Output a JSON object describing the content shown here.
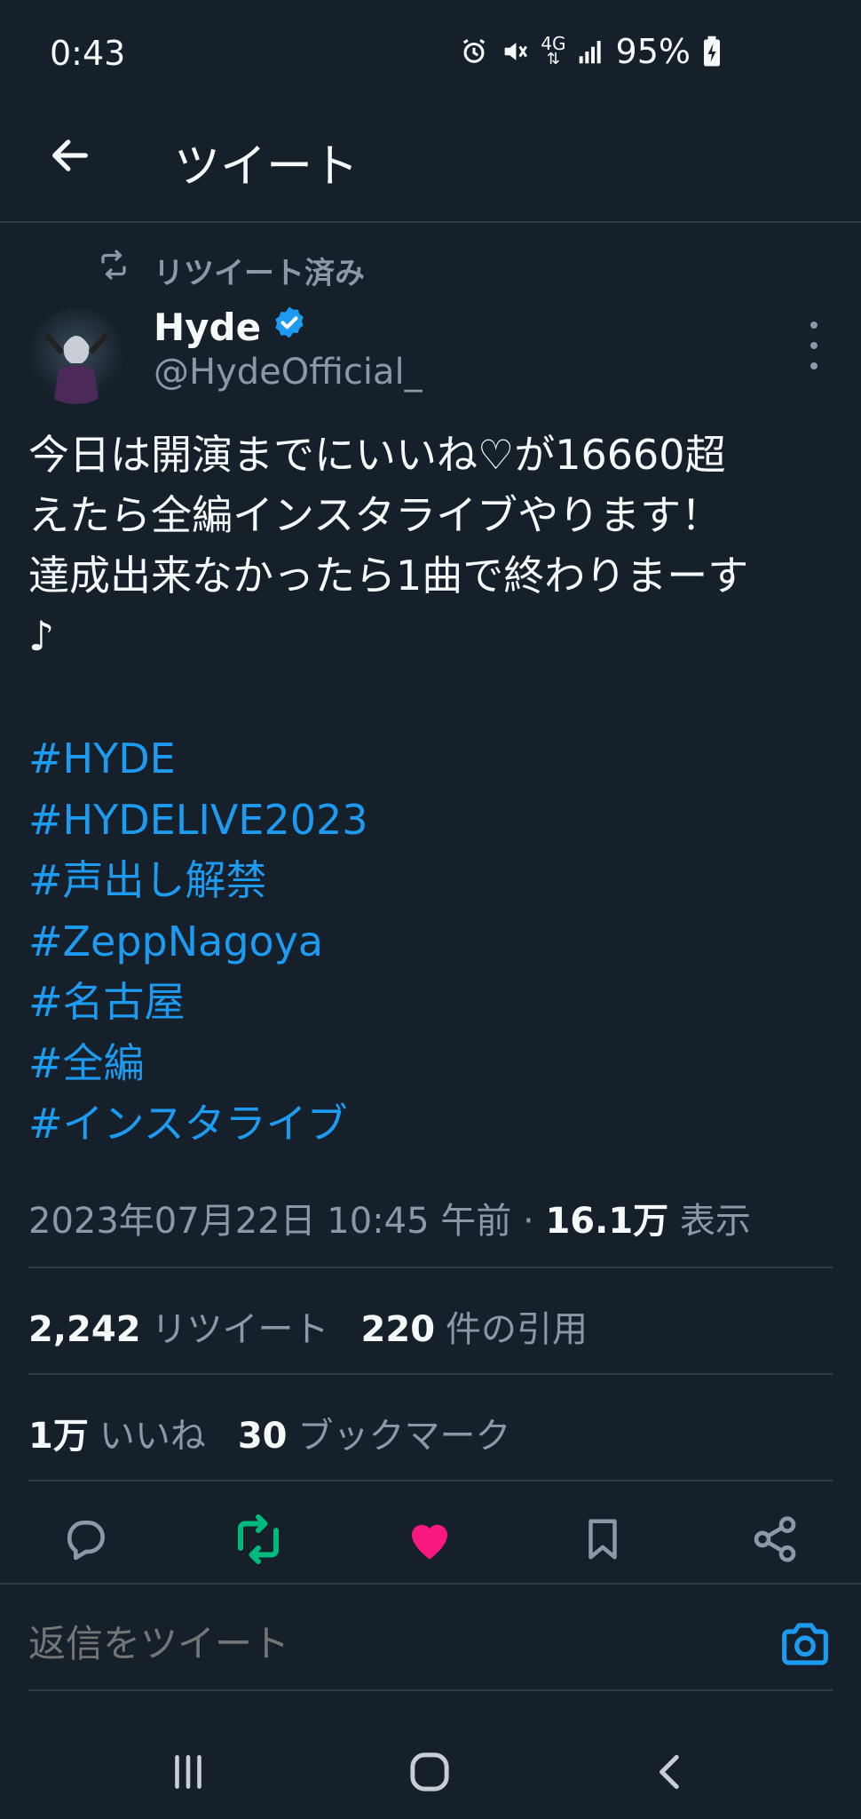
{
  "status_bar": {
    "time": "0:43",
    "network": "4G",
    "battery": "95%"
  },
  "header": {
    "title": "ツイート"
  },
  "retweet": {
    "label": "リツイート済み"
  },
  "author": {
    "name": "Hyde",
    "handle": "@HydeOfficial_",
    "verified": true
  },
  "tweet": {
    "text": "今日は開演までにいいね♡が16660超\nえたら全編インスタライブやります！\n達成出来なかったら1曲で終わりまーす\n♪",
    "hashtags": [
      "#HYDE",
      "#HYDELIVE2023",
      "#声出し解禁",
      "#ZeppNagoya",
      "#名古屋",
      "#全編",
      "#インスタライブ"
    ]
  },
  "meta": {
    "datetime": "2023年07月22日 10:45 午前 · ",
    "views_count": "16.1万",
    "views_label": " 表示"
  },
  "stats": {
    "retweets_count": "2,242",
    "retweets_label": "リツイート",
    "quotes_count": "220",
    "quotes_label": "件の引用",
    "likes_count": "1万",
    "likes_label": "いいね",
    "bookmarks_count": "30",
    "bookmarks_label": "ブックマーク"
  },
  "reply": {
    "placeholder": "返信をツイート"
  },
  "colors": {
    "background": "#15202b",
    "accent": "#1d9bf0",
    "retweet_active": "#00ba7c",
    "like_active": "#f91880",
    "muted": "#8b98a5"
  }
}
